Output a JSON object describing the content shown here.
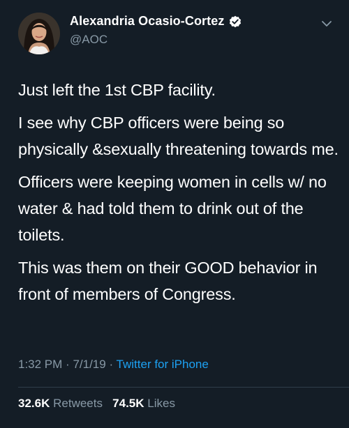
{
  "user": {
    "display_name": "Alexandria Ocasio-Cortez",
    "handle": "@AOC",
    "verified": true
  },
  "icons": {
    "verified": "verified-badge-icon",
    "menu": "chevron-down-icon"
  },
  "tweet": {
    "paragraphs": [
      "Just left the 1st CBP facility.",
      "I see why CBP officers were being so physically &sexually threatening towards me.",
      "Officers were keeping women in cells w/ no water & had told them to drink out of the toilets.",
      "This was them on their GOOD behavior in front of members of Congress."
    ],
    "time": "1:32 PM",
    "date": "7/1/19",
    "separator": "·",
    "source": "Twitter for iPhone"
  },
  "stats": {
    "retweets_count": "32.6K",
    "retweets_label": "Retweets",
    "likes_count": "74.5K",
    "likes_label": "Likes"
  },
  "colors": {
    "background": "#141d26",
    "text": "#ffffff",
    "secondary_text": "#8899a6",
    "link": "#1da1f2",
    "divider": "#2f3d4a"
  }
}
